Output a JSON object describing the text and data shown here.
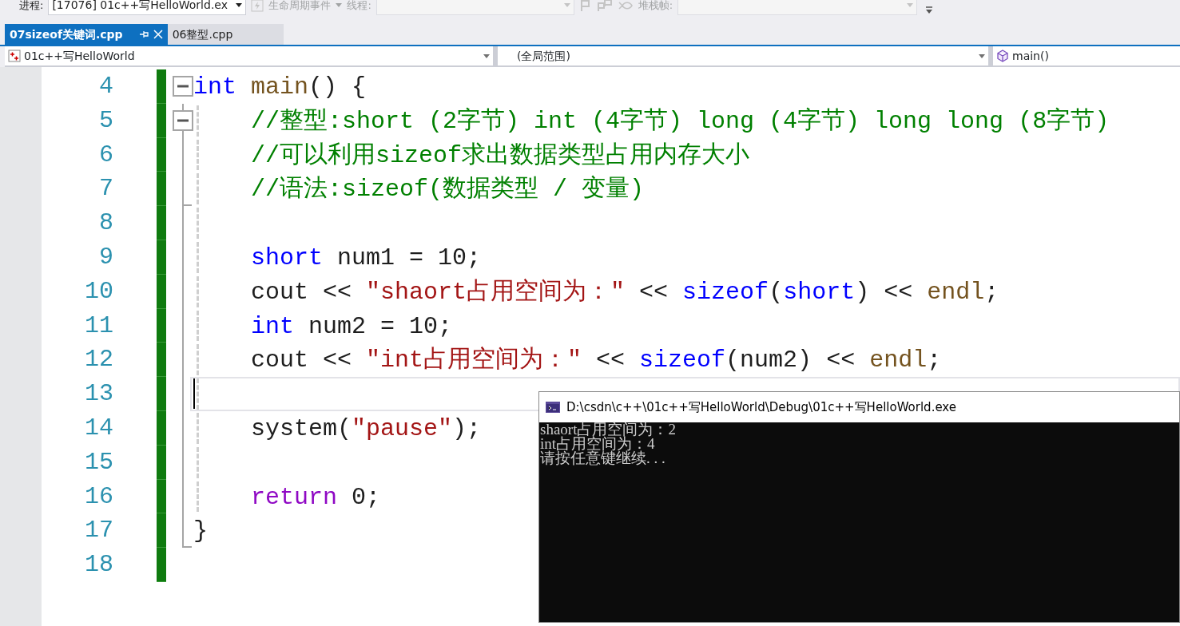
{
  "toolbar": {
    "process_label": "进程:",
    "process_value": "[17076] 01c++写HelloWorld.ex",
    "lifecycle_label": "生命周期事件",
    "thread_label": "线程:",
    "stack_label": "堆栈帧:"
  },
  "tabs": [
    {
      "label": "07sizeof关键词.cpp",
      "selected": true
    },
    {
      "label": "06整型.cpp",
      "selected": false
    }
  ],
  "navbar": {
    "project": "01c++写HelloWorld",
    "scope": "(全局范围)",
    "member": "main()"
  },
  "code_lines": [
    {
      "number": "4",
      "fold_box": true,
      "fold_line": false,
      "fold_end": false,
      "guide": false,
      "changed": true,
      "current": false,
      "tokens": [
        {
          "kind": "keyword",
          "text": "int"
        },
        {
          "kind": "function",
          "text": " main"
        },
        {
          "kind": "text",
          "text": "() {"
        }
      ]
    },
    {
      "number": "5",
      "fold_box": true,
      "fold_line": true,
      "fold_end": false,
      "guide": true,
      "changed": true,
      "current": false,
      "tokens": [
        {
          "kind": "comment",
          "text": "    //整型:short (2字节) int (4字节) long (4字节) long long (8字节)"
        }
      ]
    },
    {
      "number": "6",
      "fold_box": false,
      "fold_line": true,
      "fold_end": false,
      "guide": true,
      "changed": true,
      "current": false,
      "tokens": [
        {
          "kind": "comment",
          "text": "    //可以利用sizeof求出数据类型占用内存大小"
        }
      ]
    },
    {
      "number": "7",
      "fold_box": false,
      "fold_line": true,
      "fold_end": true,
      "guide": true,
      "changed": true,
      "current": false,
      "tokens": [
        {
          "kind": "comment",
          "text": "    //语法:sizeof(数据类型 / 变量)"
        }
      ]
    },
    {
      "number": "8",
      "fold_box": false,
      "fold_line": true,
      "fold_end": false,
      "guide": true,
      "changed": true,
      "current": false
    },
    {
      "number": "9",
      "fold_box": false,
      "fold_line": true,
      "fold_end": false,
      "guide": true,
      "changed": true,
      "current": false,
      "tokens": [
        {
          "kind": "keyword",
          "text": "    short"
        },
        {
          "kind": "text",
          "text": " num1 = 10;"
        }
      ]
    },
    {
      "number": "10",
      "fold_box": false,
      "fold_line": true,
      "fold_end": false,
      "guide": true,
      "changed": true,
      "current": false,
      "tokens": [
        {
          "kind": "text",
          "text": "    cout << "
        },
        {
          "kind": "string",
          "text": "\"shaort占用空间为：\""
        },
        {
          "kind": "text",
          "text": " << "
        },
        {
          "kind": "keyword",
          "text": "sizeof"
        },
        {
          "kind": "text",
          "text": "("
        },
        {
          "kind": "keyword",
          "text": "short"
        },
        {
          "kind": "text",
          "text": ") << "
        },
        {
          "kind": "function",
          "text": "endl"
        },
        {
          "kind": "text",
          "text": ";"
        }
      ]
    },
    {
      "number": "11",
      "fold_box": false,
      "fold_line": true,
      "fold_end": false,
      "guide": true,
      "changed": true,
      "current": false,
      "tokens": [
        {
          "kind": "keyword",
          "text": "    int"
        },
        {
          "kind": "text",
          "text": " num2 = 10;"
        }
      ]
    },
    {
      "number": "12",
      "fold_box": false,
      "fold_line": true,
      "fold_end": false,
      "guide": true,
      "changed": true,
      "current": false,
      "tokens": [
        {
          "kind": "text",
          "text": "    cout << "
        },
        {
          "kind": "string",
          "text": "\"int占用空间为：\""
        },
        {
          "kind": "text",
          "text": " << "
        },
        {
          "kind": "keyword",
          "text": "sizeof"
        },
        {
          "kind": "text",
          "text": "(num2) << "
        },
        {
          "kind": "function",
          "text": "endl"
        },
        {
          "kind": "text",
          "text": ";"
        }
      ]
    },
    {
      "number": "13",
      "fold_box": false,
      "fold_line": true,
      "fold_end": false,
      "guide": true,
      "changed": true,
      "current": true
    },
    {
      "number": "14",
      "fold_box": false,
      "fold_line": true,
      "fold_end": false,
      "guide": true,
      "changed": true,
      "current": false,
      "tokens": [
        {
          "kind": "text",
          "text": "    system("
        },
        {
          "kind": "string",
          "text": "\"pause\""
        },
        {
          "kind": "text",
          "text": ");"
        }
      ]
    },
    {
      "number": "15",
      "fold_box": false,
      "fold_line": true,
      "fold_end": false,
      "guide": true,
      "changed": true,
      "current": false
    },
    {
      "number": "16",
      "fold_box": false,
      "fold_line": true,
      "fold_end": false,
      "guide": true,
      "changed": true,
      "current": false,
      "tokens": [
        {
          "kind": "control",
          "text": "    return"
        },
        {
          "kind": "text",
          "text": " 0;"
        }
      ]
    },
    {
      "number": "17",
      "fold_box": false,
      "fold_line": true,
      "fold_end": true,
      "guide": false,
      "changed": true,
      "current": false,
      "tokens": [
        {
          "kind": "text",
          "text": "}"
        }
      ]
    },
    {
      "number": "18",
      "fold_box": false,
      "fold_line": false,
      "fold_end": false,
      "guide": false,
      "changed": true,
      "current": false
    }
  ],
  "console": {
    "title": "D:\\csdn\\c++\\01c++写HelloWorld\\Debug\\01c++写HelloWorld.exe",
    "lines": [
      "shaort占用空间为：2",
      "int占用空间为：4",
      "请按任意键继续. . ."
    ]
  }
}
